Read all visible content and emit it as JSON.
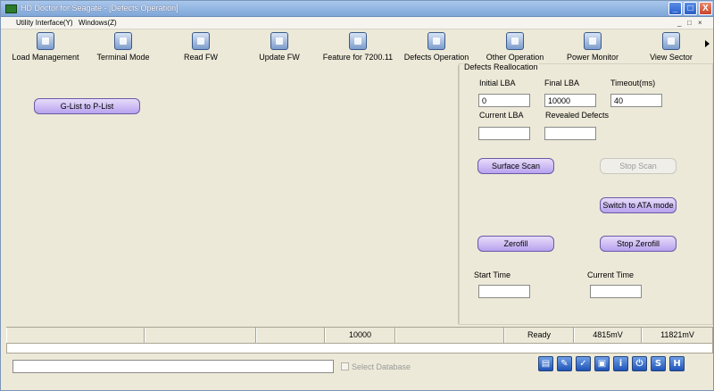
{
  "window": {
    "title": "HD Doctor for Seagate - [Defects Operation]",
    "min": "_",
    "max": "□",
    "close": "X"
  },
  "menu": {
    "items": [
      "Utility Interface(Y)",
      "Windows(Z)"
    ],
    "mdi_controls": [
      "_",
      "□",
      "×"
    ]
  },
  "toolbar": {
    "items": [
      {
        "label": "Load Management",
        "icon": "load-management-icon"
      },
      {
        "label": "Terminal Mode",
        "icon": "terminal-mode-icon"
      },
      {
        "label": "Read FW",
        "icon": "read-fw-icon"
      },
      {
        "label": "Update FW",
        "icon": "update-fw-icon"
      },
      {
        "label": "Feature for 7200.11",
        "icon": "feature-icon"
      },
      {
        "label": "Defects Operation",
        "icon": "defects-operation-icon"
      },
      {
        "label": "Other Operation",
        "icon": "other-operation-icon"
      },
      {
        "label": "Power Monitor",
        "icon": "power-monitor-icon"
      },
      {
        "label": "View Sector",
        "icon": "view-sector-icon"
      }
    ]
  },
  "left": {
    "glist_button": "G-List to P-List"
  },
  "defects": {
    "group_title": "Defects Reallocation",
    "initial_lba_label": "Initial LBA",
    "final_lba_label": "Final LBA",
    "timeout_label": "Timeout(ms)",
    "initial_lba_value": "0",
    "final_lba_value": "10000",
    "timeout_value": "40",
    "current_lba_label": "Current LBA",
    "revealed_defects_label": "Revealed Defects",
    "current_lba_value": "",
    "revealed_defects_value": "",
    "surface_scan": "Surface Scan",
    "stop_scan": "Stop Scan",
    "switch_ata": "Switch to ATA mode",
    "zerofill": "Zerofill",
    "stop_zerofill": "Stop Zerofill",
    "start_time_label": "Start Time",
    "current_time_label": "Current Time",
    "start_time_value": "",
    "current_time_value": ""
  },
  "status": {
    "cells": [
      "",
      "",
      "",
      "10000",
      "",
      "Ready",
      "4815mV",
      "11821mV"
    ]
  },
  "bottom": {
    "path_value": "",
    "select_database": "Select Database",
    "icons": [
      {
        "name": "folder-open-icon",
        "glyph": "▤"
      },
      {
        "name": "edit-icon",
        "glyph": "✎"
      },
      {
        "name": "check-icon",
        "glyph": "✓"
      },
      {
        "name": "save-icon",
        "glyph": "▣"
      },
      {
        "name": "info-icon",
        "glyph": "i"
      },
      {
        "name": "power-icon",
        "glyph": "⏻"
      },
      {
        "name": "s-icon",
        "glyph": "S"
      },
      {
        "name": "h-icon",
        "glyph": "H"
      }
    ]
  }
}
